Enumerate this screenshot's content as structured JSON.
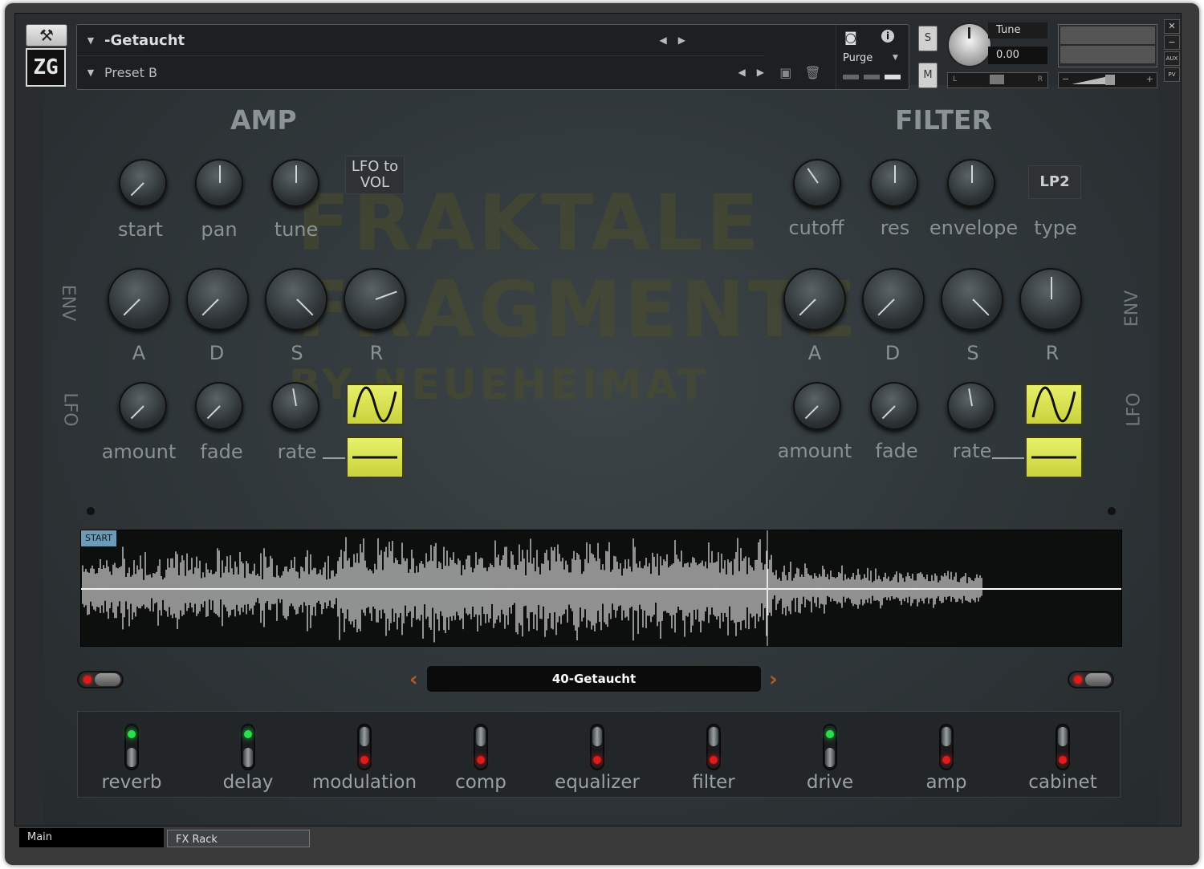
{
  "header": {
    "instrument_name": "-Getaucht",
    "preset_name": "Preset B",
    "purge_label": "Purge",
    "solo_label": "S",
    "mute_label": "M",
    "tune_label": "Tune",
    "tune_value": "0.00",
    "pan_left": "L",
    "pan_right": "R",
    "vol_minus": "−",
    "vol_plus": "+",
    "side_buttons": [
      "✕",
      "−",
      "AUX",
      "PV"
    ],
    "logo": "ZG"
  },
  "amp": {
    "title": "AMP",
    "lfo_to_vol": "LFO to VOL",
    "knob_labels": [
      "start",
      "pan",
      "tune"
    ],
    "env_labels": [
      "A",
      "D",
      "S",
      "R"
    ],
    "lfo_labels": [
      "amount",
      "fade",
      "rate"
    ]
  },
  "filter": {
    "title": "FILTER",
    "type_value": "LP2",
    "knob_labels": [
      "cutoff",
      "res",
      "envelope",
      "type"
    ],
    "env_labels": [
      "A",
      "D",
      "S",
      "R"
    ],
    "lfo_labels": [
      "amount",
      "fade",
      "rate"
    ]
  },
  "side_labels": {
    "env": "ENV",
    "lfo": "LFO"
  },
  "waveform": {
    "start_label": "START"
  },
  "sample_name": "40-Getaucht",
  "fx": [
    {
      "label": "reverb",
      "on": true
    },
    {
      "label": "delay",
      "on": true
    },
    {
      "label": "modulation",
      "on": false
    },
    {
      "label": "comp",
      "on": false
    },
    {
      "label": "equalizer",
      "on": false
    },
    {
      "label": "filter",
      "on": false
    },
    {
      "label": "drive",
      "on": true
    },
    {
      "label": "amp",
      "on": false
    },
    {
      "label": "cabinet",
      "on": false
    }
  ],
  "tabs": [
    "Main",
    "FX Rack"
  ],
  "watermark": [
    "FRAKTALE",
    "FRAGMENTE",
    "BY NEUEHEIMAT"
  ],
  "colors": {
    "led_green": "#27e04a",
    "led_red": "#e21a1a",
    "lfo_yellow": "#d8e04c",
    "accent_orange": "#b45a1e"
  }
}
